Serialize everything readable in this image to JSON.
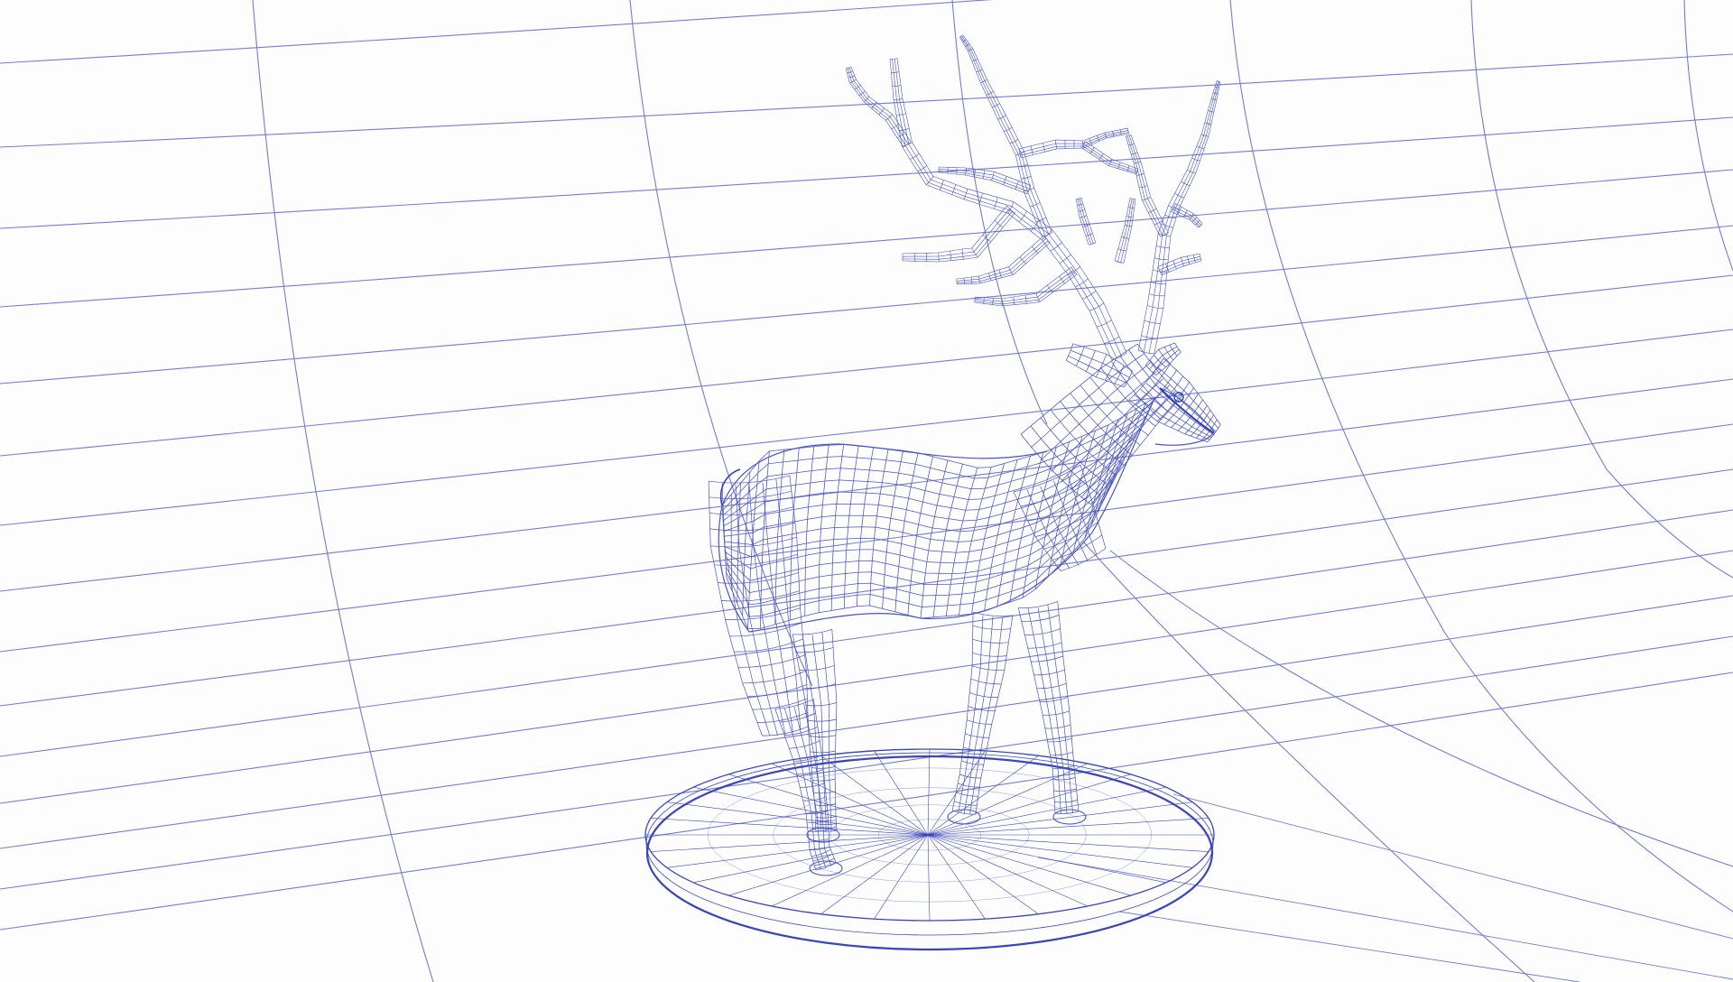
{
  "scene": {
    "subject": "deer-figurine-on-oval-base",
    "render_style": "wireframe",
    "colors": {
      "background": "#fdfdfe",
      "grid_line": "#5c67c6",
      "mesh_line": "#4a55c0",
      "mesh_dense": "#3240b0",
      "base_edge": "#3a46b8"
    }
  }
}
